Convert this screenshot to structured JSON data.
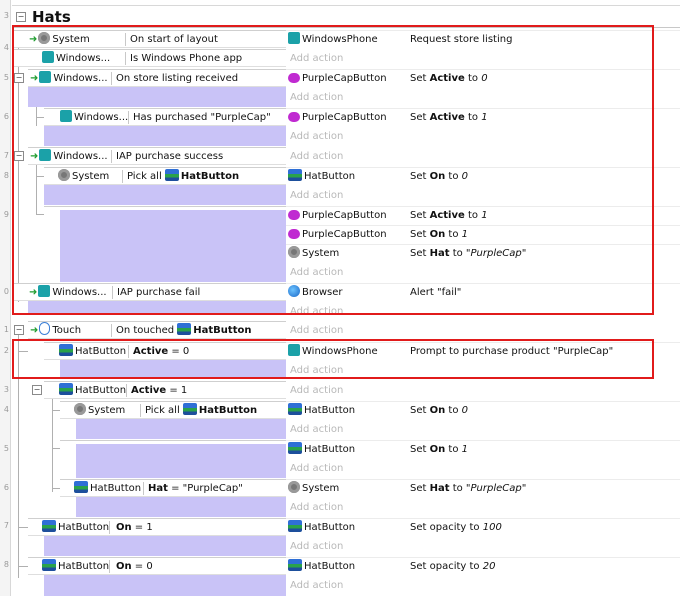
{
  "group": {
    "title": "Hats",
    "line_number": "3"
  },
  "line_numbers": [
    "4",
    "5",
    "6",
    "7",
    "8",
    "9",
    "0",
    "1",
    "2",
    "3",
    "4",
    "5",
    "6",
    "7",
    "8"
  ],
  "add_action": "Add action",
  "events": {
    "e1": {
      "c1_obj": "System",
      "c1_txt": "On start of layout",
      "c2_obj": "Windows...",
      "c2_txt": "Is Windows Phone app",
      "a1_obj": "WindowsPhone",
      "a1_txt": "Request store listing"
    },
    "e2": {
      "c_obj": "Windows...",
      "c_txt": "On store listing received",
      "a_obj": "PurpleCapButton",
      "a_pre": "Set ",
      "a_bold": "Active",
      "a_mid": " to ",
      "a_val": "0"
    },
    "e2s": {
      "c_obj": "Windows...",
      "c_txt": "Has purchased \"PurpleCap\"",
      "a_obj": "PurpleCapButton",
      "a_pre": "Set ",
      "a_bold": "Active",
      "a_mid": " to ",
      "a_val": "1"
    },
    "e3": {
      "c_obj": "Windows...",
      "c_txt": "IAP purchase success"
    },
    "e3s1": {
      "c_obj": "System",
      "c_pre": "Pick all ",
      "c_bold": "HatButton",
      "a_obj": "HatButton",
      "a_pre": "Set ",
      "a_bold": "On",
      "a_mid": " to ",
      "a_val": "0"
    },
    "e3s2": {
      "a1_obj": "PurpleCapButton",
      "a1_pre": "Set ",
      "a1_bold": "Active",
      "a1_mid": " to ",
      "a1_val": "1",
      "a2_obj": "PurpleCapButton",
      "a2_pre": "Set ",
      "a2_bold": "On",
      "a2_mid": " to ",
      "a2_val": "1",
      "a3_obj": "System",
      "a3_pre": "Set ",
      "a3_bold": "Hat",
      "a3_mid": " to ",
      "a3_val": "\"PurpleCap\""
    },
    "e4": {
      "c_obj": "Windows...",
      "c_txt": "IAP purchase fail",
      "a_obj": "Browser",
      "a_txt": "Alert \"fail\""
    },
    "e5": {
      "c_obj": "Touch",
      "c_pre": "On touched ",
      "c_bold": "HatButton"
    },
    "e5s1": {
      "c_obj": "HatButton",
      "c_bold": "Active",
      "c_txt": " = 0",
      "a_obj": "WindowsPhone",
      "a_txt": "Prompt to purchase product \"PurpleCap\""
    },
    "e5s2": {
      "c_obj": "HatButton",
      "c_bold": "Active",
      "c_txt": " = 1"
    },
    "e5s2a": {
      "c_obj": "System",
      "c_pre": "Pick all ",
      "c_bold": "HatButton",
      "a_obj": "HatButton",
      "a_pre": "Set ",
      "a_bold": "On",
      "a_mid": " to ",
      "a_val": "0"
    },
    "e5s2b": {
      "a_obj": "HatButton",
      "a_pre": "Set ",
      "a_bold": "On",
      "a_mid": " to ",
      "a_val": "1"
    },
    "e5s2c": {
      "c_obj": "HatButton",
      "c_bold": "Hat",
      "c_txt": " = \"PurpleCap\"",
      "a_obj": "System",
      "a_pre": "Set ",
      "a_bold": "Hat",
      "a_mid": " to ",
      "a_val": "\"PurpleCap\""
    },
    "e6": {
      "c_obj": "HatButton",
      "c_bold": "On",
      "c_txt": " = 1",
      "a_obj": "HatButton",
      "a_txt": "Set opacity to ",
      "a_val": "100"
    },
    "e7": {
      "c_obj": "HatButton",
      "c_bold": "On",
      "c_txt": " = 0",
      "a_obj": "HatButton",
      "a_txt": "Set opacity to ",
      "a_val": "20"
    }
  },
  "colors": {
    "highlight": "#e11b1b",
    "padding": "#c9c3f7",
    "trigger_arrow": "#1f9c2f"
  }
}
